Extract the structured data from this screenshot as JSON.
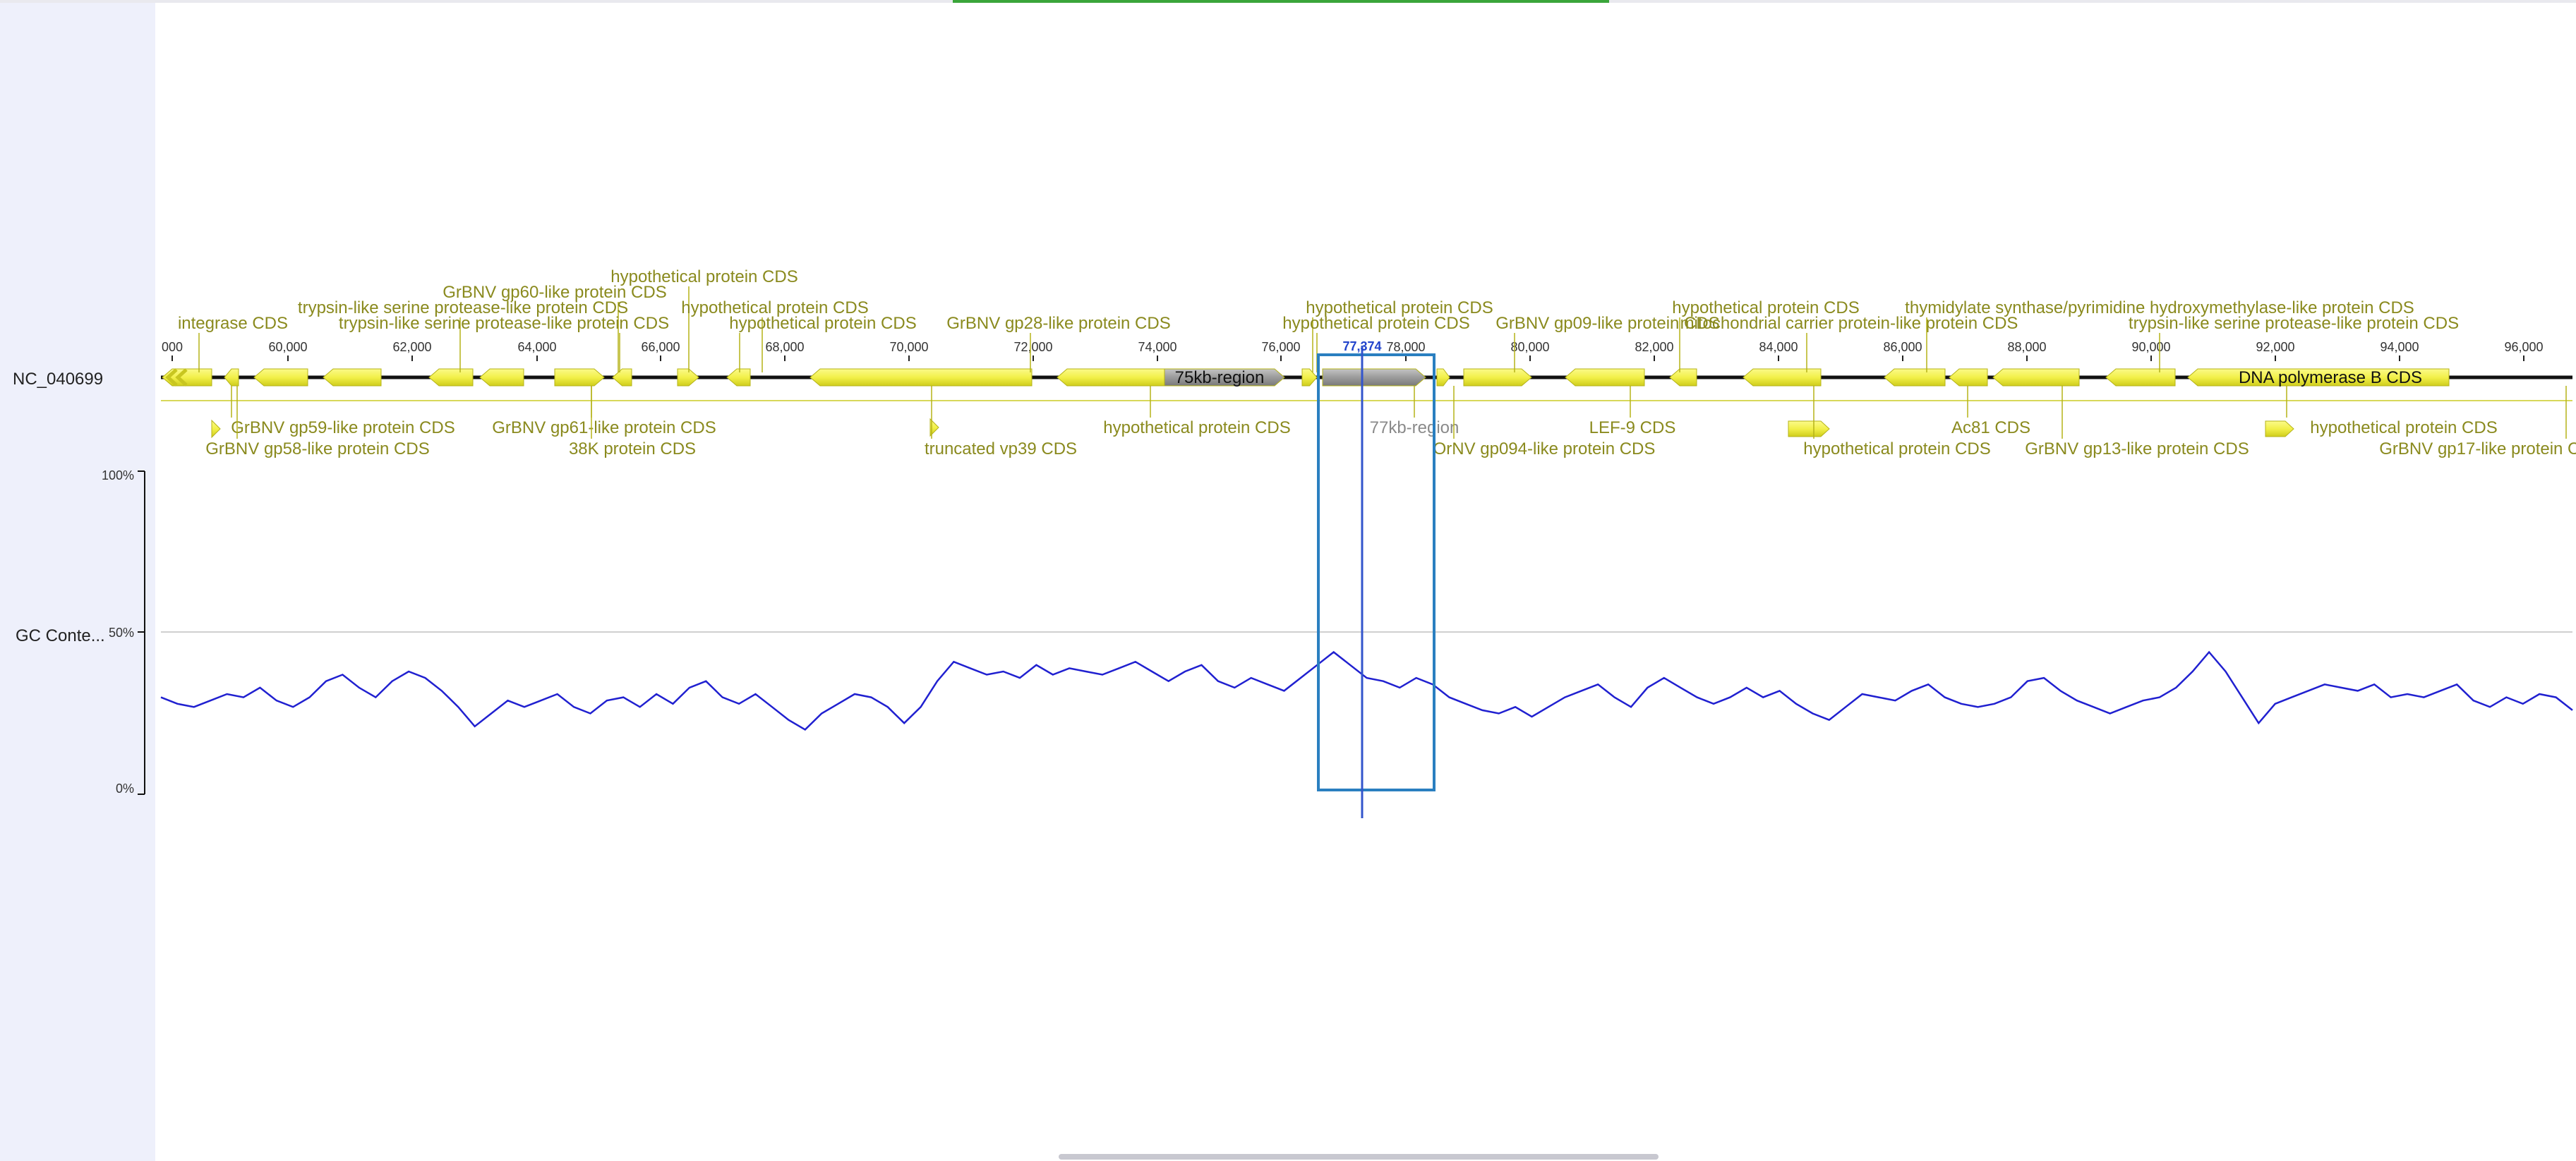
{
  "sequence_name": "NC_040699",
  "gc_track_label": "GC Conte...",
  "gc_axis": {
    "top": "100%",
    "mid": "50%",
    "bottom": "0%"
  },
  "cursor_position": "77,374",
  "ruler_ticks": [
    "000",
    "60,000",
    "62,000",
    "64,000",
    "66,000",
    "68,000",
    "70,000",
    "72,000",
    "74,000",
    "76,000",
    "78,000",
    "80,000",
    "82,000",
    "84,000",
    "86,000",
    "88,000",
    "90,000",
    "92,000",
    "94,000",
    "96,000"
  ],
  "labels_above": [
    "hypothetical protein CDS",
    "GrBNV gp60-like protein CDS",
    "trypsin-like serine protease-like protein CDS",
    "hypothetical protein CDS",
    "integrase CDS",
    "trypsin-like serine protease-like protein CDS",
    "hypothetical protein CDS",
    "GrBNV gp28-like protein CDS",
    "hypothetical protein CDS",
    "hypothetical protein CDS",
    "GrBNV gp09-like protein CDS",
    "hypothetical protein CDS",
    "mitochondrial carrier protein-like protein CDS",
    "thymidylate synthase/pyrimidine hydroxymethylase-like protein CDS",
    "trypsin-like serine protease-like protein CDS"
  ],
  "labels_below": [
    "GrBNV gp59-like protein CDS",
    "GrBNV gp58-like protein CDS",
    "GrBNV gp61-like protein CDS",
    "38K protein CDS",
    "truncated vp39 CDS",
    "hypothetical protein CDS",
    "77kb-region",
    "OrNV gp094-like protein CDS",
    "LEF-9 CDS",
    "hypothetical protein CDS",
    "Ac81 CDS",
    "GrBNV gp13-like protein CDS",
    "hypothetical protein CDS",
    "GrBNV gp17-like protein CDS"
  ],
  "inline_labels": {
    "region_75kb": "75kb-region",
    "dna_pol": "DNA polymerase B CDS"
  },
  "colors": {
    "cds": "#f2f04a",
    "cds_label": "#8a8a1e",
    "region": "#9b9b9b",
    "gc_line": "#2020d0",
    "selection": "#2a7fc0"
  },
  "gc_content": [
    0.3,
    0.28,
    0.27,
    0.29,
    0.31,
    0.3,
    0.33,
    0.29,
    0.27,
    0.3,
    0.35,
    0.37,
    0.33,
    0.3,
    0.35,
    0.38,
    0.36,
    0.32,
    0.27,
    0.21,
    0.25,
    0.29,
    0.27,
    0.29,
    0.31,
    0.27,
    0.25,
    0.29,
    0.3,
    0.27,
    0.31,
    0.28,
    0.33,
    0.35,
    0.3,
    0.28,
    0.31,
    0.27,
    0.23,
    0.2,
    0.25,
    0.28,
    0.31,
    0.3,
    0.27,
    0.22,
    0.27,
    0.35,
    0.41,
    0.39,
    0.37,
    0.38,
    0.36,
    0.4,
    0.37,
    0.39,
    0.38,
    0.37,
    0.39,
    0.41,
    0.38,
    0.35,
    0.38,
    0.4,
    0.35,
    0.33,
    0.36,
    0.34,
    0.32,
    0.36,
    0.4,
    0.44,
    0.4,
    0.36,
    0.35,
    0.33,
    0.36,
    0.34,
    0.3,
    0.28,
    0.26,
    0.25,
    0.27,
    0.24,
    0.27,
    0.3,
    0.32,
    0.34,
    0.3,
    0.27,
    0.33,
    0.36,
    0.33,
    0.3,
    0.28,
    0.3,
    0.33,
    0.3,
    0.32,
    0.28,
    0.25,
    0.23,
    0.27,
    0.31,
    0.3,
    0.29,
    0.32,
    0.34,
    0.3,
    0.28,
    0.27,
    0.28,
    0.3,
    0.35,
    0.36,
    0.32,
    0.29,
    0.27,
    0.25,
    0.27,
    0.29,
    0.3,
    0.33,
    0.38,
    0.44,
    0.38,
    0.3,
    0.22,
    0.28,
    0.3,
    0.32,
    0.34,
    0.33,
    0.32,
    0.34,
    0.3,
    0.31,
    0.3,
    0.32,
    0.34,
    0.29,
    0.27,
    0.3,
    0.28,
    0.31,
    0.3,
    0.26
  ]
}
